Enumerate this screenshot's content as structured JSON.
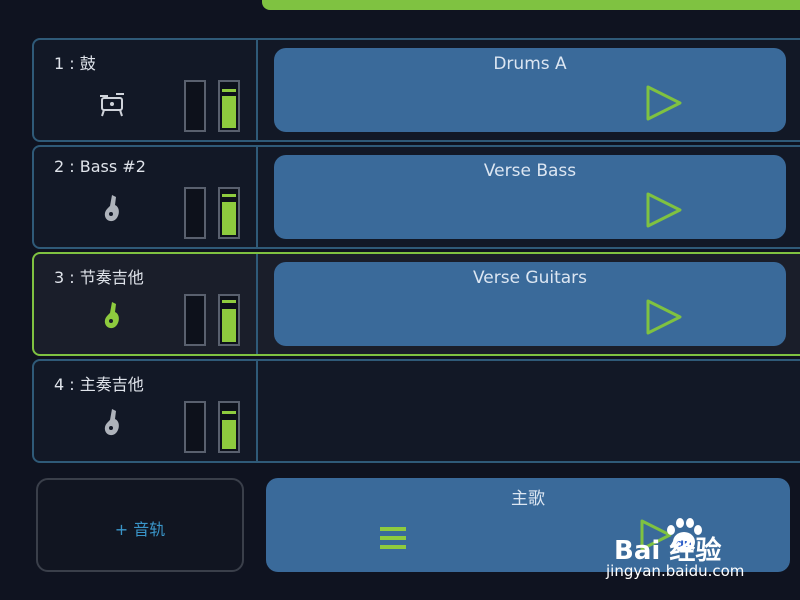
{
  "tracks": [
    {
      "name": "1 : 鼓",
      "icon": "drum-kit-icon",
      "icon_color": "#cfd3da",
      "meter_left_level": 0,
      "meter_right_level": 0.72,
      "meter_right_peak": 0.82,
      "clip": {
        "name": "Drums A"
      },
      "selected": false
    },
    {
      "name": "2 : Bass #2",
      "icon": "bass-guitar-icon",
      "icon_color": "#aeb3bb",
      "meter_left_level": 0,
      "meter_right_level": 0.74,
      "meter_right_peak": 0.86,
      "clip": {
        "name": "Verse Bass"
      },
      "selected": false
    },
    {
      "name": "3 : 节奏吉他",
      "icon": "guitar-icon",
      "icon_color": "#8ecb3e",
      "meter_left_level": 0,
      "meter_right_level": 0.76,
      "meter_right_peak": 0.88,
      "clip": {
        "name": "Verse Guitars"
      },
      "selected": true
    },
    {
      "name": "4 : 主奏吉他",
      "icon": "guitar-icon",
      "icon_color": "#aeb3bb",
      "meter_left_level": 0,
      "meter_right_level": 0.66,
      "meter_right_peak": 0.8,
      "clip": null,
      "selected": false
    }
  ],
  "add_track": {
    "label": "+ 音轨"
  },
  "scene": {
    "name": "主歌"
  },
  "watermark": {
    "brand": "Bai  经验",
    "url": "jingyan.baidu.com"
  },
  "colors": {
    "accent_green": "#8ecb3e",
    "clip_blue": "#3a6a9a",
    "border_blue": "#2f5a78",
    "background": "#0f1320",
    "add_track_text": "#3a95c9"
  }
}
